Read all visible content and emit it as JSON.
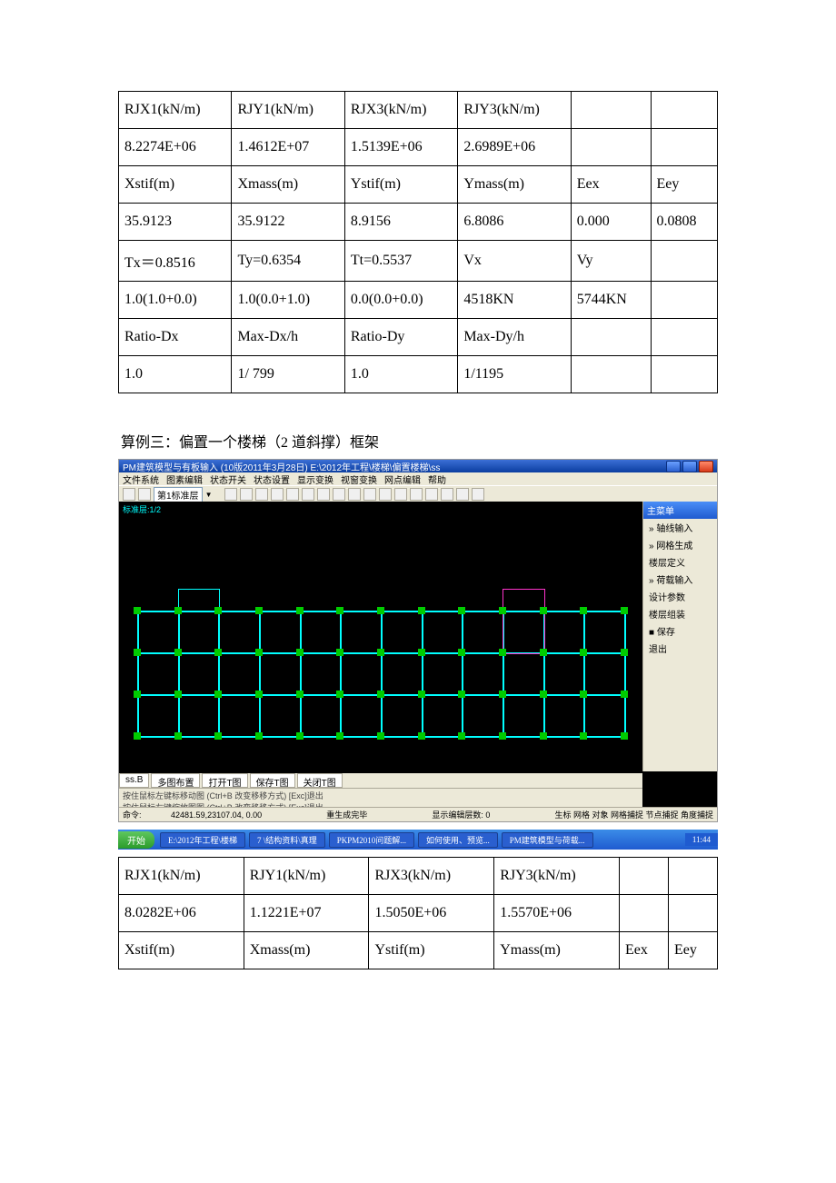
{
  "table1": {
    "rows": [
      [
        "RJX1(kN/m)",
        "RJY1(kN/m)",
        "RJX3(kN/m)",
        "RJY3(kN/m)",
        "",
        ""
      ],
      [
        "8.2274E+06",
        "1.4612E+07",
        "1.5139E+06",
        "2.6989E+06",
        "",
        ""
      ],
      [
        "Xstif(m)",
        "Xmass(m)",
        "Ystif(m)",
        "Ymass(m)",
        "Eex",
        "Eey"
      ],
      [
        "35.9123",
        "35.9122",
        "8.9156",
        "6.8086",
        "0.000",
        "0.0808"
      ],
      [
        "Tx＝0.8516",
        "Ty=0.6354",
        "Tt=0.5537",
        "Vx",
        "Vy",
        ""
      ],
      [
        "1.0(1.0+0.0)",
        "1.0(0.0+1.0)",
        "0.0(0.0+0.0)",
        "4518KN",
        "5744KN",
        ""
      ],
      [
        "Ratio-Dx",
        "Max-Dx/h",
        "Ratio-Dy",
        "Max-Dy/h",
        "",
        ""
      ],
      [
        "1.0",
        "1/ 799",
        "1.0",
        "1/1195",
        "",
        ""
      ]
    ]
  },
  "caption": "算例三：偏置一个楼梯（2 道斜撑）框架",
  "screenshot": {
    "title": "PM建筑模型与有板输入 (10版2011年3月28日)  E:\\2012年工程\\楼梯\\偏置楼梯\\ss",
    "menubar": [
      "文件系统",
      "图素编辑",
      "状态开关",
      "状态设置",
      "显示变换",
      "视窗变换",
      "网点编辑",
      "帮助"
    ],
    "toolbar_floor_label": "第1标准层",
    "sidepanel": {
      "title": "主菜单",
      "items": [
        "轴线输入",
        "网格生成",
        "楼层定义",
        "荷载输入",
        "设计参数",
        "楼层组装",
        "保存",
        "退出"
      ]
    },
    "tabs": [
      "ss.B",
      "多图布置",
      "打开T图",
      "保存T图",
      "关闭T图"
    ],
    "cmd_lines": [
      "按住鼠标左键标移动图 (Ctrl+B 改变移移方式) [Exc]退出",
      "按住鼠标左键缩放图图 (Ctrl+B 改变移移方式) [Exc]退出",
      "命令:"
    ],
    "status_center_left": "重生成完毕",
    "status_center_right": "显示编辑层数: 0",
    "status_right": "生标 网格 对象 网格捕捉 节点捕捉 角度捕捉",
    "coords": "42481.59,23107.04, 0.00",
    "taskbar": {
      "start": "开始",
      "items": [
        "E:\\2012年工程\\楼梯",
        "7 \\结构资料\\真理",
        "PKPM2010问题解...",
        "如何使用、预览...",
        "PM建筑模型与荷载..."
      ],
      "tray": "11:44"
    },
    "canvas_label": "标准层:1/2"
  },
  "table2": {
    "rows": [
      [
        "RJX1(kN/m)",
        "RJY1(kN/m)",
        "RJX3(kN/m)",
        "RJY3(kN/m)",
        "",
        ""
      ],
      [
        "8.0282E+06",
        "1.1221E+07",
        "1.5050E+06",
        "1.5570E+06",
        "",
        ""
      ],
      [
        "Xstif(m)",
        "Xmass(m)",
        "Ystif(m)",
        "Ymass(m)",
        "Eex",
        "Eey"
      ]
    ]
  }
}
